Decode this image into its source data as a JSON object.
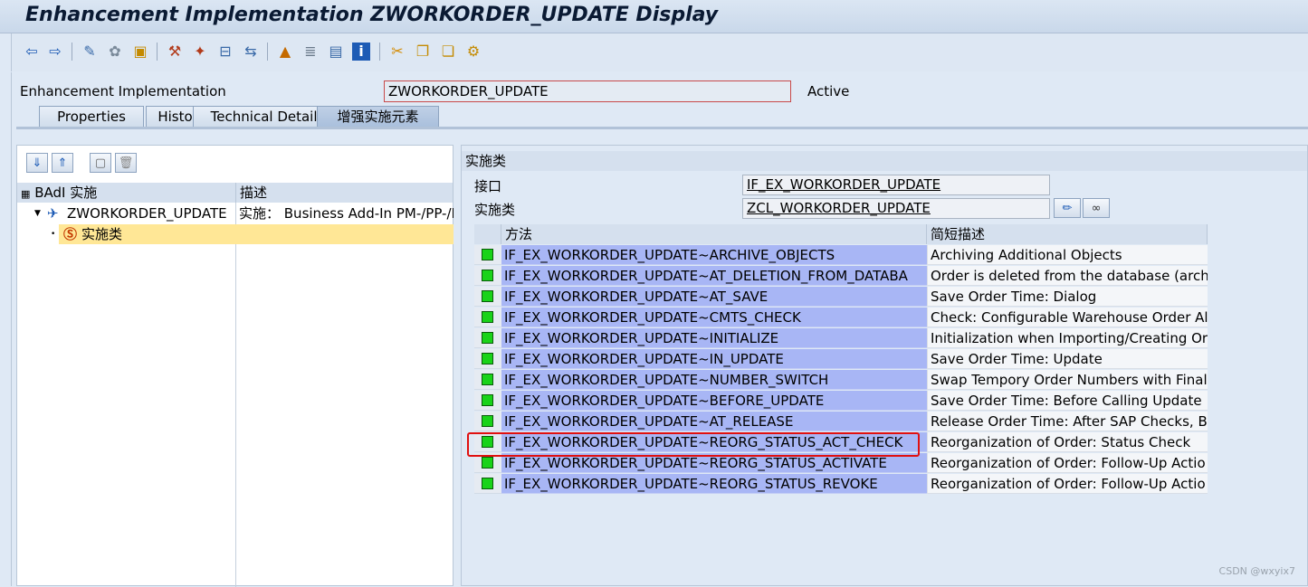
{
  "window": {
    "title": "Enhancement Implementation ZWORKORDER_UPDATE Display"
  },
  "toolbar": {
    "icons": [
      "back-arrow-icon",
      "forward-arrow-icon",
      "other-object-icon",
      "display-change-icon",
      "activate-icon",
      "check-icon",
      "test-icon",
      "where-used-icon",
      "object-list-icon",
      "navigation-icon",
      "display-object-list-icon",
      "info-icon",
      "cut-icon",
      "copy-icon",
      "paste-icon",
      "hierarchy-icon"
    ]
  },
  "header": {
    "impl_label": "Enhancement Implementation",
    "impl_value": "ZWORKORDER_UPDATE",
    "status": "Active"
  },
  "tabs": [
    {
      "label": "Properties",
      "active": false
    },
    {
      "label": "History",
      "active": false
    },
    {
      "label": "Technical Details",
      "active": false
    },
    {
      "label": "增强实施元素",
      "active": true
    }
  ],
  "tree": {
    "col1": "BAdI 实施",
    "col2": "描述",
    "root_name": "ZWORKORDER_UPDATE",
    "root_desc": "实施： Business Add-In PM-/PP-/I",
    "child_name": "实施类"
  },
  "impl_class": {
    "section_title": "实施类",
    "interface_label": "接口",
    "interface_value": "IF_EX_WORKORDER_UPDATE",
    "class_label": "实施类",
    "class_value": "ZCL_WORKORDER_UPDATE"
  },
  "methods": {
    "col_method": "方法",
    "col_desc": "简短描述",
    "rows": [
      {
        "method": "IF_EX_WORKORDER_UPDATE~ARCHIVE_OBJECTS",
        "desc": "Archiving Additional Objects"
      },
      {
        "method": "IF_EX_WORKORDER_UPDATE~AT_DELETION_FROM_DATABA",
        "desc": "Order is deleted from the database (archi"
      },
      {
        "method": "IF_EX_WORKORDER_UPDATE~AT_SAVE",
        "desc": "Save Order Time: Dialog"
      },
      {
        "method": "IF_EX_WORKORDER_UPDATE~CMTS_CHECK",
        "desc": "Check: Configurable Warehouse Order All"
      },
      {
        "method": "IF_EX_WORKORDER_UPDATE~INITIALIZE",
        "desc": "Initialization when Importing/Creating Or"
      },
      {
        "method": "IF_EX_WORKORDER_UPDATE~IN_UPDATE",
        "desc": "Save Order Time: Update"
      },
      {
        "method": "IF_EX_WORKORDER_UPDATE~NUMBER_SWITCH",
        "desc": "Swap Tempory Order Numbers with Final"
      },
      {
        "method": "IF_EX_WORKORDER_UPDATE~BEFORE_UPDATE",
        "desc": "Save Order Time: Before Calling Update"
      },
      {
        "method": "IF_EX_WORKORDER_UPDATE~AT_RELEASE",
        "desc": "Release Order Time: After SAP Checks, B"
      },
      {
        "method": "IF_EX_WORKORDER_UPDATE~REORG_STATUS_ACT_CHECK",
        "desc": "Reorganization of Order: Status Check"
      },
      {
        "method": "IF_EX_WORKORDER_UPDATE~REORG_STATUS_ACTIVATE",
        "desc": "Reorganization of Order: Follow-Up Actio"
      },
      {
        "method": "IF_EX_WORKORDER_UPDATE~REORG_STATUS_REVOKE",
        "desc": "Reorganization of Order: Follow-Up Actio"
      }
    ]
  },
  "watermark": "CSDN @wxyix7"
}
